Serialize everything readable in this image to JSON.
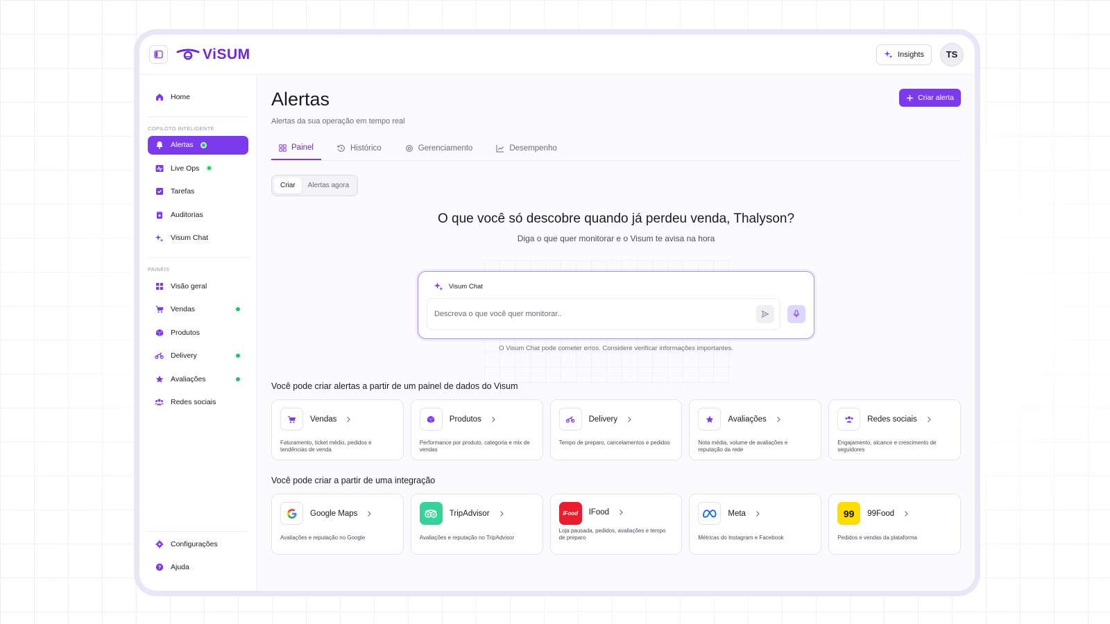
{
  "brand": {
    "name": "ViSUM",
    "accent": "#7c3aed"
  },
  "header": {
    "insights_label": "Insights",
    "avatar_initials": "TS"
  },
  "sidebar": {
    "home": "Home",
    "section1": "COPILOTO INTELIGENTE",
    "copilot": [
      {
        "label": "Alertas"
      },
      {
        "label": "Live Ops"
      },
      {
        "label": "Tarefas"
      },
      {
        "label": "Auditorias"
      },
      {
        "label": "Visum Chat"
      }
    ],
    "section2": "PAINÉIS",
    "panels": [
      {
        "label": "Visão geral"
      },
      {
        "label": "Vendas"
      },
      {
        "label": "Produtos"
      },
      {
        "label": "Delivery"
      },
      {
        "label": "Avaliações"
      },
      {
        "label": "Redes sociais"
      }
    ],
    "settings": "Configurações",
    "help": "Ajuda"
  },
  "main": {
    "title": "Alertas",
    "subtitle": "Alertas da sua operação em tempo real",
    "create_button": "Criar alerta",
    "tabs": [
      {
        "label": "Painel"
      },
      {
        "label": "Histórico"
      },
      {
        "label": "Gerenciamento"
      },
      {
        "label": "Desempenho"
      }
    ],
    "segment": [
      {
        "label": "Criar"
      },
      {
        "label": "Alertas agora"
      }
    ],
    "hero_title": "O que você só descobre quando já perdeu venda, Thalyson?",
    "hero_subtitle": "Diga o que quer monitorar e o Visum te avisa na hora",
    "chat": {
      "title": "Visum Chat",
      "placeholder": "Descreva o que você quer monitorar..",
      "disclaimer": "O Visum Chat pode cometer erros. Considere verificar informações importantes."
    },
    "panels_section_title": "Você pode criar alertas a partir de um painel de dados do Visum",
    "panel_cards": [
      {
        "label": "Vendas",
        "desc": "Faturamento, ticket médio, pedidos e tendências de venda"
      },
      {
        "label": "Produtos",
        "desc": "Performance por produto, categoria e mix de vendas"
      },
      {
        "label": "Delivery",
        "desc": "Tempo de preparo, cancelamentos e pedidos"
      },
      {
        "label": "Avaliações",
        "desc": "Nota média, volume de avaliações e reputação da rede"
      },
      {
        "label": "Redes sociais",
        "desc": "Engajamento, alcance e crescimento de seguidores"
      }
    ],
    "integrations_section_title": "Você pode criar a partir de uma integração",
    "integration_cards": [
      {
        "label": "Google Maps",
        "desc": "Avaliações e reputação no Google"
      },
      {
        "label": "TripAdvisor",
        "desc": "Avaliações e reputação no TripAdvisor"
      },
      {
        "label": "IFood",
        "desc": "Loja pausada, pedidos, avaliações e tempo de preparo",
        "logo_text": "iFood"
      },
      {
        "label": "Meta",
        "desc": "Métricas do Instagram e Facebook"
      },
      {
        "label": "99Food",
        "desc": "Pedidos e vendas da plataforma",
        "logo_text": "99"
      }
    ]
  }
}
